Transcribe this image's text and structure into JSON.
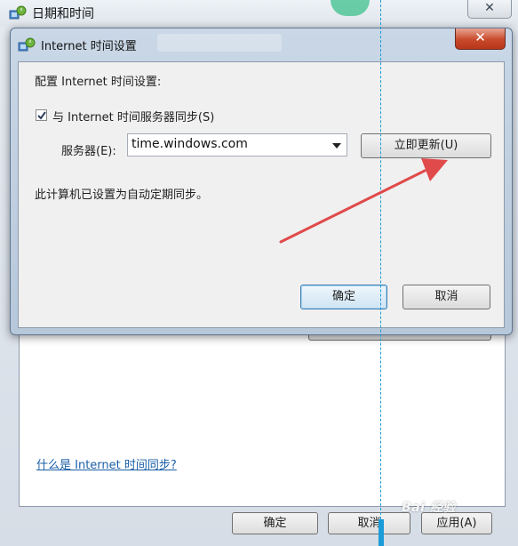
{
  "background_window": {
    "title": "日期和时间",
    "link": "什么是 Internet 时间同步?",
    "buttons": {
      "ok": "确定",
      "cancel": "取消",
      "apply": "应用(A)"
    }
  },
  "dialog": {
    "title": "Internet 时间设置",
    "heading": "配置 Internet 时间设置:",
    "sync_checkbox": {
      "label": "与 Internet 时间服务器同步(S)",
      "checked": true
    },
    "server_label": "服务器(E):",
    "server_value": "time.windows.com",
    "update_button": "立即更新(U)",
    "status": "此计算机已设置为自动定期同步。",
    "ok_button": "确定",
    "cancel_button": "取消"
  },
  "icons": {
    "close": "close-icon",
    "window": "clock-globe-icon",
    "dropdown": "chevron-down-icon",
    "check": "checkmark-icon"
  },
  "colors": {
    "dialog_frame": "#c9d7e6",
    "close_button": "#c9492b",
    "annotation_arrow": "#e04a4a",
    "guide_line": "#1b9cd8",
    "link": "#1a5ea6"
  },
  "watermark": "Bai 经验"
}
